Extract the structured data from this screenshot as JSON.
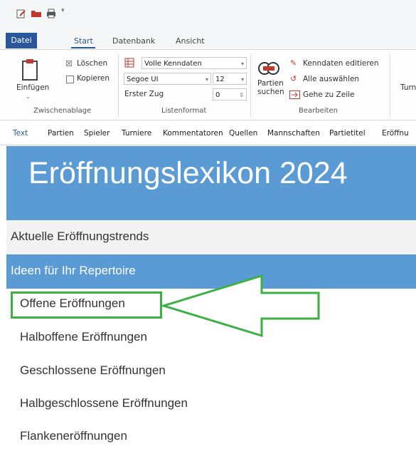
{
  "ribbon_tabs": {
    "datei": "Datei",
    "start": "Start",
    "datenbank": "Datenbank",
    "ansicht": "Ansicht"
  },
  "ribbon": {
    "clipboard": {
      "paste": "Einfügen",
      "delete": "Löschen",
      "copy": "Kopieren",
      "group": "Zwischenablage"
    },
    "list_format": {
      "kenndaten_select": "Volle Kenndaten",
      "font_select": "Segoe UI",
      "size_select": "12",
      "first_move_label": "Erster Zug",
      "first_move_value": "0",
      "group": "Listenformat"
    },
    "edit": {
      "search_games": "Partien suchen",
      "edit_kenndaten": "Kenndaten editieren",
      "select_all": "Alle auswählen",
      "goto_line": "Gehe zu Zeile",
      "group": "Bearbeiten"
    },
    "tournament_partial": "Turn"
  },
  "view_tabs": [
    "Text",
    "Partien",
    "Spieler",
    "Turniere",
    "Kommentatoren",
    "Quellen",
    "Mannschaften",
    "Partietitel",
    "Eröffnu"
  ],
  "content": {
    "title": "Eröffnungslexikon 2024",
    "trends": "Aktuelle Eröffnungstrends",
    "ideas": "Ideen für Ihr Repertoire",
    "items": [
      "Offene Eröffnungen",
      "Halboffene Eröffnungen",
      "Geschlossene Eröffnungen",
      "Halbgeschlossene Eröffnungen",
      "Flankeneröffnungen"
    ]
  },
  "colors": {
    "accent": "#2b579a",
    "banner": "#5b9bd5",
    "highlight": "#3cb043"
  }
}
